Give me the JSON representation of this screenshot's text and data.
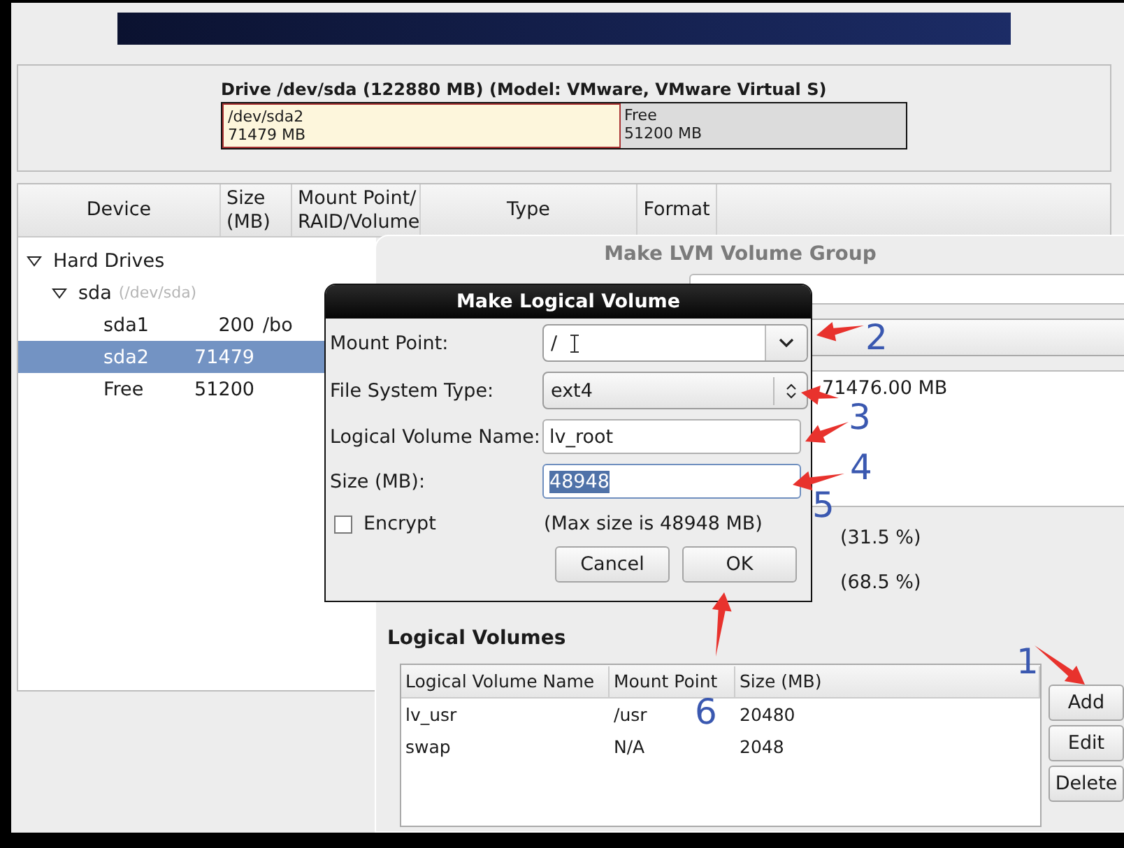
{
  "drive": {
    "title": "Drive /dev/sda (122880 MB) (Model: VMware, VMware Virtual S)",
    "segments": [
      {
        "kind": "partition",
        "name": "/dev/sda2",
        "size": "71479 MB",
        "level": 0.5818
      },
      {
        "kind": "free",
        "name": "Free",
        "size": "51200 MB",
        "level": 0.4182
      }
    ]
  },
  "device_table": {
    "columns": [
      "Device",
      "Size\n(MB)",
      "Mount Point/\nRAID/Volume",
      "Type",
      "Format"
    ],
    "rows": [
      {
        "device": "Hard Drives",
        "expanded": true,
        "selected": false,
        "children": [
          {
            "device": "sda",
            "hint": "(/dev/sda)",
            "expanded": true,
            "selected": false,
            "children": [
              {
                "device": "sda1",
                "size": "200",
                "mount": "/bo",
                "selected": false
              },
              {
                "device": "sda2",
                "size": "71479",
                "selected": true
              },
              {
                "device": "Free",
                "size": "51200",
                "selected": false
              }
            ]
          }
        ]
      }
    ]
  },
  "lvm_dialog": {
    "title": "Make LVM Volume Group",
    "extent_reading": "71476.00 MB",
    "percentages": [
      "(31.5 %)",
      "(68.5 %)"
    ],
    "logical_volumes": {
      "heading": "Logical Volumes",
      "columns": [
        "Logical Volume Name",
        "Mount Point",
        "Size (MB)"
      ],
      "rows": [
        {
          "name": "lv_usr",
          "mount": "/usr",
          "size": "20480"
        },
        {
          "name": "swap",
          "mount": "N/A",
          "size": "2048"
        }
      ]
    },
    "buttons": [
      "Add",
      "Edit",
      "Delete"
    ]
  },
  "lv_dialog": {
    "title": "Make Logical Volume",
    "fields": [
      {
        "kind": "combo",
        "label": "Mount Point:",
        "value": "/"
      },
      {
        "kind": "select",
        "label": "File System Type:",
        "value": "ext4"
      },
      {
        "kind": "entry",
        "label": "Logical Volume Name:",
        "value": "lv_root",
        "text_selected": false
      },
      {
        "kind": "entry",
        "label": "Size (MB):",
        "value": "48948",
        "text_selected": true
      }
    ],
    "encrypt": {
      "label": "Encrypt",
      "checked": false
    },
    "max_size": "(Max size is 48948 MB)",
    "buttons": [
      "Cancel",
      "OK"
    ]
  },
  "annotations": [
    {
      "number": "1"
    },
    {
      "number": "2"
    },
    {
      "number": "3"
    },
    {
      "number": "4"
    },
    {
      "number": "5"
    },
    {
      "number": "6"
    }
  ]
}
